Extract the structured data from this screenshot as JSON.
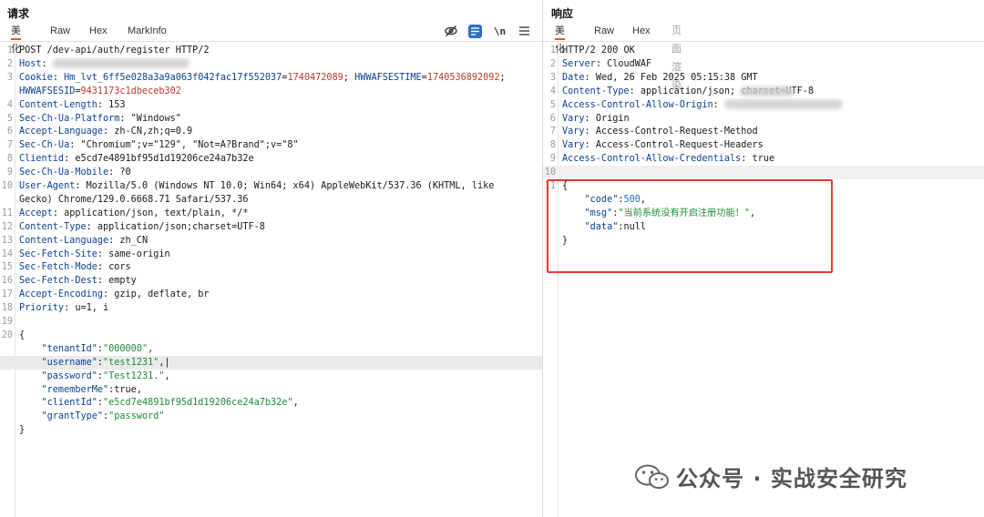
{
  "request": {
    "title": "请求",
    "tabs": [
      "美化",
      "Raw",
      "Hex",
      "MarkInfo"
    ],
    "active_tab": 0,
    "tools": {
      "hide_icon": "eye-off-icon",
      "wrap_icon": "text-wrap-icon",
      "newline_label": "\\n",
      "menu_icon": "hamburger-menu-icon"
    },
    "lines": [
      {
        "n": "1",
        "parts": [
          {
            "t": "POST /dev-api/auth/register HTTP/2",
            "c": "hv"
          }
        ]
      },
      {
        "n": "2",
        "parts": [
          {
            "t": "Host",
            "c": "hk"
          },
          {
            "t": ": ",
            "c": "hv"
          }
        ]
      },
      {
        "n": "3",
        "parts": [
          {
            "t": "Cookie",
            "c": "hk"
          },
          {
            "t": ": ",
            "c": "hv"
          },
          {
            "t": "Hm_lvt_6ff5e028a3a9a063f042fac17f552037",
            "c": "hk"
          },
          {
            "t": "=",
            "c": "hv"
          },
          {
            "t": "1740472089",
            "c": "rd"
          },
          {
            "t": "; ",
            "c": "hv"
          },
          {
            "t": "HWWAFSESTIME",
            "c": "hk"
          },
          {
            "t": "=",
            "c": "hv"
          },
          {
            "t": "1740536892092",
            "c": "rd"
          },
          {
            "t": ";",
            "c": "hv"
          }
        ]
      },
      {
        "n": "",
        "parts": [
          {
            "t": "HWWAFSESID",
            "c": "hk"
          },
          {
            "t": "=",
            "c": "hv"
          },
          {
            "t": "9431173c1dbeceb302",
            "c": "rd"
          }
        ]
      },
      {
        "n": "4",
        "parts": [
          {
            "t": "Content-Length",
            "c": "hk"
          },
          {
            "t": ": 153",
            "c": "hv"
          }
        ]
      },
      {
        "n": "5",
        "parts": [
          {
            "t": "Sec-Ch-Ua-Platform",
            "c": "hk"
          },
          {
            "t": ": \"Windows\"",
            "c": "hv"
          }
        ]
      },
      {
        "n": "6",
        "parts": [
          {
            "t": "Accept-Language",
            "c": "hk"
          },
          {
            "t": ": zh-CN,zh;q=0.9",
            "c": "hv"
          }
        ]
      },
      {
        "n": "7",
        "parts": [
          {
            "t": "Sec-Ch-Ua",
            "c": "hk"
          },
          {
            "t": ": \"Chromium\";v=\"129\", \"Not=A?Brand\";v=\"8\"",
            "c": "hv"
          }
        ]
      },
      {
        "n": "8",
        "parts": [
          {
            "t": "Clientid",
            "c": "hk"
          },
          {
            "t": ": e5cd7e4891bf95d1d19206ce24a7b32e",
            "c": "hv"
          }
        ]
      },
      {
        "n": "9",
        "parts": [
          {
            "t": "Sec-Ch-Ua-Mobile",
            "c": "hk"
          },
          {
            "t": ": ?0",
            "c": "hv"
          }
        ]
      },
      {
        "n": "10",
        "parts": [
          {
            "t": "User-Agent",
            "c": "hk"
          },
          {
            "t": ": Mozilla/5.0 (Windows NT 10.0; Win64; x64) AppleWebKit/537.36 (KHTML, like",
            "c": "hv"
          }
        ]
      },
      {
        "n": "",
        "parts": [
          {
            "t": "Gecko) Chrome/129.0.6668.71 Safari/537.36",
            "c": "hv"
          }
        ]
      },
      {
        "n": "11",
        "parts": [
          {
            "t": "Accept",
            "c": "hk"
          },
          {
            "t": ": application/json, text/plain, */*",
            "c": "hv"
          }
        ]
      },
      {
        "n": "12",
        "parts": [
          {
            "t": "Content-Type",
            "c": "hk"
          },
          {
            "t": ": application/json;charset=UTF-8",
            "c": "hv"
          }
        ]
      },
      {
        "n": "13",
        "parts": [
          {
            "t": "Content-Language",
            "c": "hk"
          },
          {
            "t": ": zh_CN",
            "c": "hv"
          }
        ]
      },
      {
        "n": "14",
        "parts": [
          {
            "t": "Sec-Fetch-Site",
            "c": "hk"
          },
          {
            "t": ": same-origin",
            "c": "hv"
          }
        ]
      },
      {
        "n": "15",
        "parts": [
          {
            "t": "Sec-Fetch-Mode",
            "c": "hk"
          },
          {
            "t": ": cors",
            "c": "hv"
          }
        ]
      },
      {
        "n": "16",
        "parts": [
          {
            "t": "Sec-Fetch-Dest",
            "c": "hk"
          },
          {
            "t": ": empty",
            "c": "hv"
          }
        ]
      },
      {
        "n": "17",
        "parts": [
          {
            "t": "Accept-Encoding",
            "c": "hk"
          },
          {
            "t": ": gzip, deflate, br",
            "c": "hv"
          }
        ]
      },
      {
        "n": "18",
        "parts": [
          {
            "t": "Priority",
            "c": "hk"
          },
          {
            "t": ": u=1, i",
            "c": "hv"
          }
        ]
      },
      {
        "n": "19",
        "parts": []
      },
      {
        "n": "20",
        "parts": [
          {
            "t": "{",
            "c": "js-lit"
          }
        ]
      },
      {
        "n": "",
        "parts": [
          {
            "t": "    \"tenantId\"",
            "c": "js-key"
          },
          {
            "t": ":",
            "c": "js-lit"
          },
          {
            "t": "\"000000\"",
            "c": "js-str"
          },
          {
            "t": ",",
            "c": "js-lit"
          }
        ]
      },
      {
        "n": "",
        "cursor": true,
        "parts": [
          {
            "t": "    \"username\"",
            "c": "js-key"
          },
          {
            "t": ":",
            "c": "js-lit"
          },
          {
            "t": "\"test1231\"",
            "c": "js-str"
          },
          {
            "t": ",|",
            "c": "js-lit"
          }
        ]
      },
      {
        "n": "",
        "parts": [
          {
            "t": "    \"password\"",
            "c": "js-key"
          },
          {
            "t": ":",
            "c": "js-lit"
          },
          {
            "t": "\"Test1231.\"",
            "c": "js-str"
          },
          {
            "t": ",",
            "c": "js-lit"
          }
        ]
      },
      {
        "n": "",
        "parts": [
          {
            "t": "    \"rememberMe\"",
            "c": "js-key"
          },
          {
            "t": ":true,",
            "c": "js-lit"
          }
        ]
      },
      {
        "n": "",
        "parts": [
          {
            "t": "    \"clientId\"",
            "c": "js-key"
          },
          {
            "t": ":",
            "c": "js-lit"
          },
          {
            "t": "\"e5cd7e4891bf95d1d19206ce24a7b32e\"",
            "c": "js-str"
          },
          {
            "t": ",",
            "c": "js-lit"
          }
        ]
      },
      {
        "n": "",
        "parts": [
          {
            "t": "    \"grantType\"",
            "c": "js-key"
          },
          {
            "t": ":",
            "c": "js-lit"
          },
          {
            "t": "\"password\"",
            "c": "js-str"
          }
        ]
      },
      {
        "n": "",
        "parts": [
          {
            "t": "}",
            "c": "js-lit"
          }
        ]
      }
    ]
  },
  "response": {
    "title": "响应",
    "tabs": [
      "美化",
      "Raw",
      "Hex",
      "页面渲染"
    ],
    "active_tab": 0,
    "disabled_tab": 3,
    "lines": [
      {
        "n": "1",
        "parts": [
          {
            "t": "HTTP/2 200 OK",
            "c": "hv"
          }
        ]
      },
      {
        "n": "2",
        "parts": [
          {
            "t": "Server",
            "c": "hk"
          },
          {
            "t": ": CloudWAF",
            "c": "hv"
          }
        ]
      },
      {
        "n": "3",
        "parts": [
          {
            "t": "Date",
            "c": "hk"
          },
          {
            "t": ": Wed, 26 Feb 2025 05:15:38 GMT",
            "c": "hv"
          }
        ]
      },
      {
        "n": "4",
        "parts": [
          {
            "t": "Content-Type",
            "c": "hk"
          },
          {
            "t": ": application/json; charset=UTF-8",
            "c": "hv"
          }
        ]
      },
      {
        "n": "5",
        "parts": [
          {
            "t": "Access-Control-Allow-Origin",
            "c": "hk"
          },
          {
            "t": ": ",
            "c": "hv"
          }
        ]
      },
      {
        "n": "6",
        "parts": [
          {
            "t": "Vary",
            "c": "hk"
          },
          {
            "t": ": Origin",
            "c": "hv"
          }
        ]
      },
      {
        "n": "7",
        "parts": [
          {
            "t": "Vary",
            "c": "hk"
          },
          {
            "t": ": Access-Control-Request-Method",
            "c": "hv"
          }
        ]
      },
      {
        "n": "8",
        "parts": [
          {
            "t": "Vary",
            "c": "hk"
          },
          {
            "t": ": Access-Control-Request-Headers",
            "c": "hv"
          }
        ]
      },
      {
        "n": "9",
        "parts": [
          {
            "t": "Access-Control-Allow-Credentials",
            "c": "hk"
          },
          {
            "t": ": true",
            "c": "hv"
          }
        ]
      },
      {
        "n": "10",
        "selected": true,
        "parts": []
      },
      {
        "n": "11",
        "parts": [
          {
            "t": "{",
            "c": "js-lit"
          }
        ]
      },
      {
        "n": "",
        "parts": [
          {
            "t": "    \"code\"",
            "c": "js-key"
          },
          {
            "t": ":",
            "c": "js-lit"
          },
          {
            "t": "500",
            "c": "js-num"
          },
          {
            "t": ",",
            "c": "js-lit"
          }
        ]
      },
      {
        "n": "",
        "parts": [
          {
            "t": "    \"msg\"",
            "c": "js-key"
          },
          {
            "t": ":",
            "c": "js-lit"
          },
          {
            "t": "\"当前系统没有开启注册功能！\"",
            "c": "js-str"
          },
          {
            "t": ",",
            "c": "js-lit"
          }
        ]
      },
      {
        "n": "",
        "parts": [
          {
            "t": "    \"data\"",
            "c": "js-key"
          },
          {
            "t": ":null",
            "c": "js-lit"
          }
        ]
      },
      {
        "n": "",
        "parts": [
          {
            "t": "}",
            "c": "js-lit"
          }
        ]
      }
    ]
  },
  "watermark": {
    "icon": "wechat-icon",
    "text": "公众号 · 实战安全研究"
  }
}
